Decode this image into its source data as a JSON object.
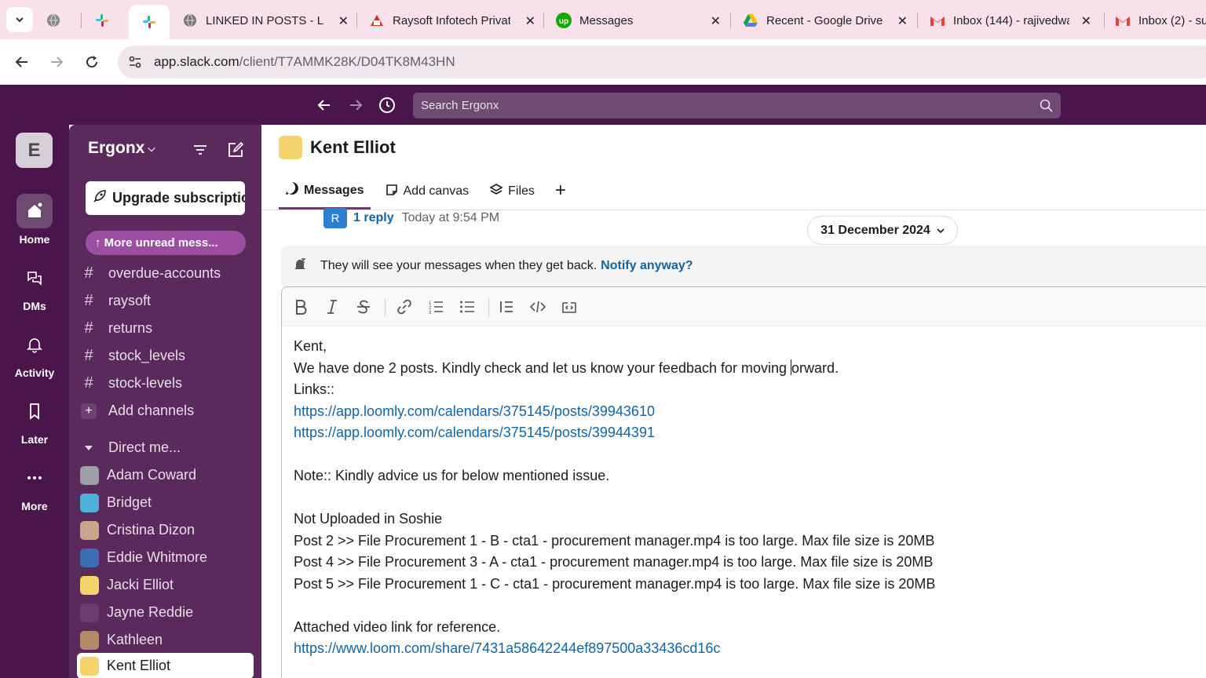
{
  "browser": {
    "tabs": [
      {
        "title": "",
        "icon": "globe-icon"
      },
      {
        "title": "",
        "icon": "slack-icon"
      },
      {
        "title": "",
        "icon": "slack-icon",
        "active": true
      },
      {
        "title": "LINKED IN POSTS - LO",
        "icon": "globe-icon"
      },
      {
        "title": "Raysoft Infotech Privat",
        "icon": "raysoft-icon"
      },
      {
        "title": "Messages",
        "icon": "upwork-icon"
      },
      {
        "title": "Recent - Google Drive",
        "icon": "google-drive-icon"
      },
      {
        "title": "Inbox (144) - rajivedwa",
        "icon": "gmail-icon"
      },
      {
        "title": "Inbox (2) - su",
        "icon": "gmail-icon"
      }
    ],
    "close_glyph": "✕",
    "url_host": "app.slack.com",
    "url_path": "/client/T7AMMK28K/D04TK8M43HN"
  },
  "slack": {
    "search_placeholder": "Search Ergonx",
    "workspace_initial": "E",
    "workspace_name": "Ergonx",
    "rail": [
      {
        "label": "Home",
        "icon": "home-icon"
      },
      {
        "label": "DMs",
        "icon": "dms-icon"
      },
      {
        "label": "Activity",
        "icon": "bell-icon"
      },
      {
        "label": "Later",
        "icon": "bookmark-icon"
      },
      {
        "label": "More",
        "icon": "more-icon"
      }
    ],
    "upgrade_label": "Upgrade subscription",
    "more_unread_label": "↑ More unread mess...",
    "channels": [
      "overdue-accounts",
      "raysoft",
      "returns",
      "stock_levels",
      "stock-levels"
    ],
    "add_channels_label": "Add channels",
    "direct_messages_label": "Direct me...",
    "dms": [
      {
        "name": "Adam Coward",
        "color": "#9aa0a6"
      },
      {
        "name": "Bridget",
        "color": "#4fb0d8"
      },
      {
        "name": "Cristina Dizon",
        "color": "#c9a58c"
      },
      {
        "name": "Eddie Whitmore",
        "color": "#3b6db5"
      },
      {
        "name": "Jacki Elliot",
        "color": "#f5d36a"
      },
      {
        "name": "Jayne Reddie",
        "color": "#6a3d6c"
      },
      {
        "name": "Kathleen",
        "color": "#b58a6a"
      },
      {
        "name": "Kent Elliot",
        "color": "#f5d36a",
        "active": true
      }
    ]
  },
  "conversation": {
    "title": "Kent Elliot",
    "tabs": [
      "Messages",
      "Add canvas",
      "Files"
    ],
    "add_tab": "+",
    "reply_avatar": "R",
    "reply_count": "1 reply",
    "reply_time": "Today at 9:54 PM",
    "date_divider": "31 December 2024",
    "notice_text": "They will see your messages when they get back.",
    "notice_link": "Notify anyway?",
    "composer": {
      "line1": "Kent,",
      "line2a": "We have done 2 posts. Kindly check and let us know your feedbach for moving ",
      "line2b": "orward.",
      "line3": "Links::",
      "link1": "https://app.loomly.com/calendars/375145/posts/39943610",
      "link2": "https://app.loomly.com/calendars/375145/posts/39944391",
      "line5": "Note:: Kindly advice us for below mentioned issue.",
      "line6": "Not Uploaded in Soshie",
      "line7": "Post 2 >> File Procurement 1 - B - cta1 - procurement manager.mp4 is too large. Max file size is 20MB",
      "line8": "Post 4 >> File Procurement 3 - A - cta1 - procurement manager.mp4 is too large. Max file size is 20MB",
      "line9": "Post 5 >> File Procurement 1 - C - cta1 - procurement manager.mp4 is too large. Max file size is 20MB",
      "line10": "Attached video link for reference.",
      "link3": "https://www.loom.com/share/7431a58642244ef897500a33436cd16c"
    }
  },
  "colors": {
    "aubergine": "#4a154b",
    "sidebar": "#5a2a5c",
    "link": "#1264a3",
    "tab_strip": "#f9e1ec"
  }
}
